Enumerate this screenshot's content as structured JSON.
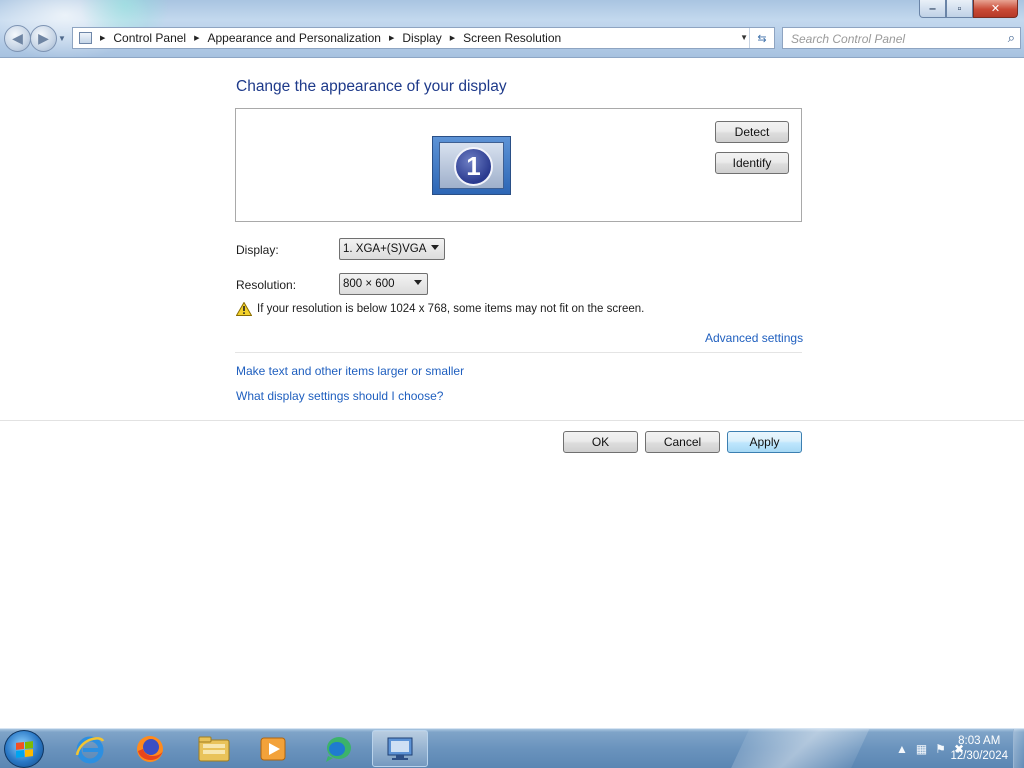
{
  "window": {
    "controls": {
      "minimize": "‒",
      "maximize": "▫",
      "close": "✕"
    }
  },
  "addressbar": {
    "breadcrumbs": [
      "Control Panel",
      "Appearance and Personalization",
      "Display",
      "Screen Resolution"
    ]
  },
  "search": {
    "placeholder": "Search Control Panel"
  },
  "content": {
    "heading": "Change the appearance of your display",
    "monitor_number": "1",
    "detect_label": "Detect",
    "identify_label": "Identify",
    "display_label": "Display:",
    "display_value": "1. XGA+(S)VGA",
    "resolution_label": "Resolution:",
    "resolution_value": "800 × 600",
    "warning": "If your resolution is below 1024 x 768, some items may not fit on the screen.",
    "advanced_link": "Advanced settings",
    "text_size_link": "Make text and other items larger or smaller",
    "help_link": "What display settings should I choose?",
    "ok_label": "OK",
    "cancel_label": "Cancel",
    "apply_label": "Apply"
  },
  "taskbar": {
    "apps": [
      {
        "name": "internet-explorer-icon"
      },
      {
        "name": "firefox-icon"
      },
      {
        "name": "windows-explorer-icon"
      },
      {
        "name": "media-player-icon"
      },
      {
        "name": "chat-icon"
      },
      {
        "name": "display-settings-icon",
        "active": true
      }
    ],
    "clock_time": "8:03 AM",
    "clock_date": "12/30/2024"
  },
  "colors": {
    "heading": "#1e3a8a",
    "link": "#1f5fbf",
    "taskbar": "#6a93bd",
    "apply_border": "#3c7fb1"
  }
}
